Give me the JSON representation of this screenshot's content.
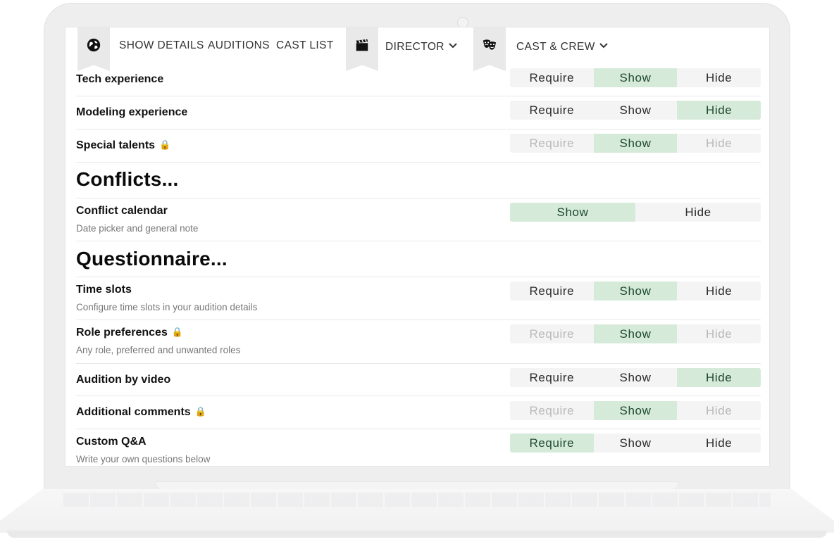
{
  "nav": {
    "items": {
      "show_details": "SHOW DETAILS",
      "auditions": "AUDITIONS",
      "cast_list": "CAST LIST",
      "director": "DIRECTOR",
      "cast_crew": "CAST & CREW"
    },
    "icons": [
      "globe-icon",
      "clapperboard-icon",
      "theater-masks-icon",
      "chevron-down-icon"
    ]
  },
  "options": {
    "require": "Require",
    "show": "Show",
    "hide": "Hide"
  },
  "rows": {
    "tech": {
      "label": "Tech experience",
      "selected": "show",
      "locked": false
    },
    "modeling": {
      "label": "Modeling experience",
      "selected": "hide",
      "locked": false
    },
    "special": {
      "label": "Special talents",
      "selected": "show",
      "locked": true
    },
    "conflict": {
      "label": "Conflict calendar",
      "sub": "Date picker and general note",
      "selected": "show"
    },
    "time_slots": {
      "label": "Time slots",
      "sub": "Configure time slots in your audition details",
      "selected": "show",
      "locked": false
    },
    "role_prefs": {
      "label": "Role preferences",
      "sub": "Any role, preferred and unwanted roles",
      "selected": "show",
      "locked": true
    },
    "video": {
      "label": "Audition by video",
      "selected": "hide",
      "locked": false
    },
    "comments": {
      "label": "Additional comments",
      "selected": "show",
      "locked": true
    },
    "custom_qa": {
      "label": "Custom Q&A",
      "sub": "Write your own questions below",
      "selected": "require",
      "locked": false
    }
  },
  "sections": {
    "conflicts": "Conflicts...",
    "questionnaire": "Questionnaire..."
  },
  "colors": {
    "selected_bg": "#d5ead9",
    "selected_text": "#214a2f",
    "segment_bg": "#f4f4f4",
    "locked_text": "#b9b9b9",
    "lock_icon": "#e0a800"
  }
}
